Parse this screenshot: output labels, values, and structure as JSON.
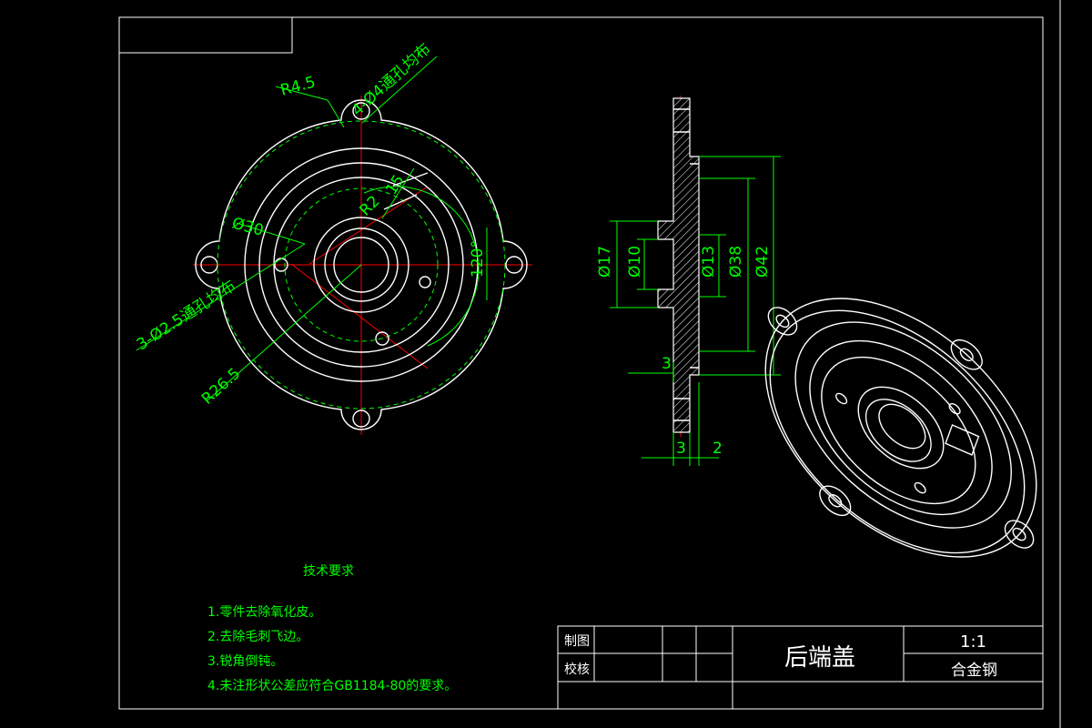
{
  "colors": {
    "background": "#000000",
    "outline": "#ffffff",
    "dimension": "#00ff00",
    "centerline": "#ff0000"
  },
  "front_view": {
    "hole_note_4": "4-Ø4通孔均布",
    "radius_45": "R4.5",
    "radius_2": "R2",
    "dim_15": "15",
    "dia_30": "Ø30",
    "hole_note_3": "3-Ø2.5通孔均布",
    "radius_265": "R26.5",
    "angle_120": "120°"
  },
  "section_view": {
    "dia_17": "Ø17",
    "dia_10": "Ø10",
    "dia_13": "Ø13",
    "dia_38": "Ø38",
    "dia_42": "Ø42",
    "thk_3a": "3",
    "thk_3b": "3",
    "thk_2": "2"
  },
  "tech_requirements": {
    "heading": "技术要求",
    "items": [
      "1.零件去除氧化皮。",
      "2.去除毛刺飞边。",
      "3.锐角倒钝。",
      "4.未注形状公差应符合GB1184-80的要求。"
    ]
  },
  "title_block": {
    "drawn_label": "制图",
    "checked_label": "校核",
    "part_name": "后端盖",
    "scale": "1:1",
    "material": "合金钢"
  }
}
